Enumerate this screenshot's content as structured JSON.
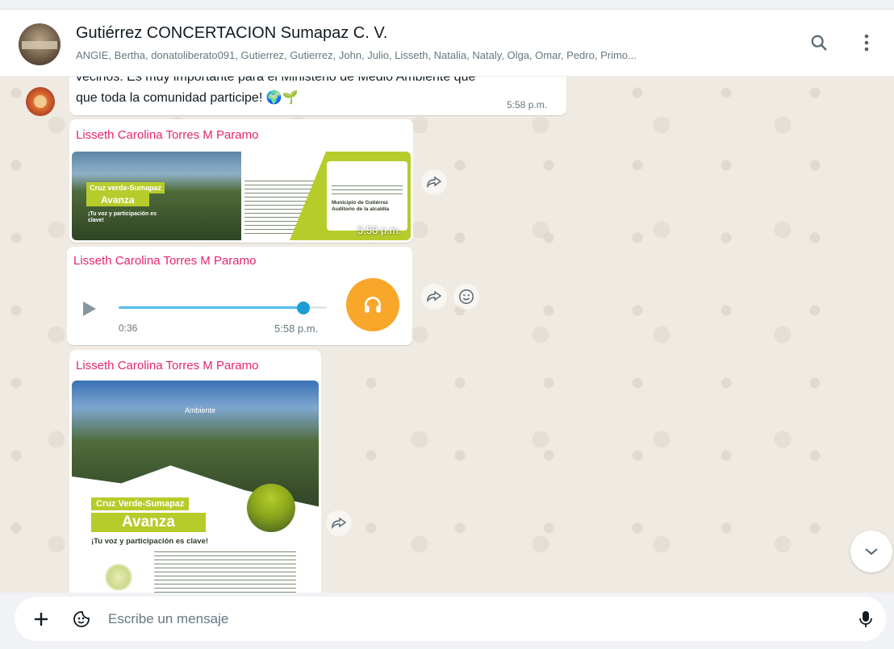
{
  "header": {
    "title": "Gutiérrez CONCERTACION Sumapaz C. V.",
    "participants": "ANGIE, Bertha, donatoliberato091, Gutierrez, Gutierrez, John, Julio, Lisseth, Natalia, Nataly, Olga, Omar, Pedro, Primo...",
    "search_icon": "search-icon",
    "menu_icon": "more-vert-icon"
  },
  "messages": [
    {
      "type": "text",
      "lines": [
        "vecinos. Es muy importante para el Ministerio de Medio Ambiente que",
        "que toda la comunidad participe! 🌍🌱"
      ],
      "time": "5:58 p.m."
    },
    {
      "type": "image",
      "sender": "Lisseth Carolina Torres M Paramo",
      "time": "5:58 p.m.",
      "poster": {
        "tag_top": "Cruz verde-Sumapaz",
        "tag_main": "Avanza",
        "slogan": "¡Tu voz y participación es clave!",
        "place": "Municipio de Gutiérrez Auditorio de la alcaldía"
      }
    },
    {
      "type": "audio",
      "sender": "Lisseth Carolina Torres M Paramo",
      "duration": "0:36",
      "time": "5:58 p.m.",
      "progress": 0.88
    },
    {
      "type": "image",
      "sender": "Lisseth Carolina Torres M Paramo",
      "poster": {
        "brand": "Ambiente",
        "tag_top": "Cruz Verde-Sumapaz",
        "tag_main": "Avanza",
        "slogan": "¡Tu voz y participación es clave!"
      }
    }
  ],
  "composer": {
    "placeholder": "Escribe un mensaje"
  },
  "colors": {
    "sender": "#e5266f",
    "accent_audio": "#f8a72b",
    "progress": "#53bdeb",
    "lime": "#b5cc2b"
  }
}
